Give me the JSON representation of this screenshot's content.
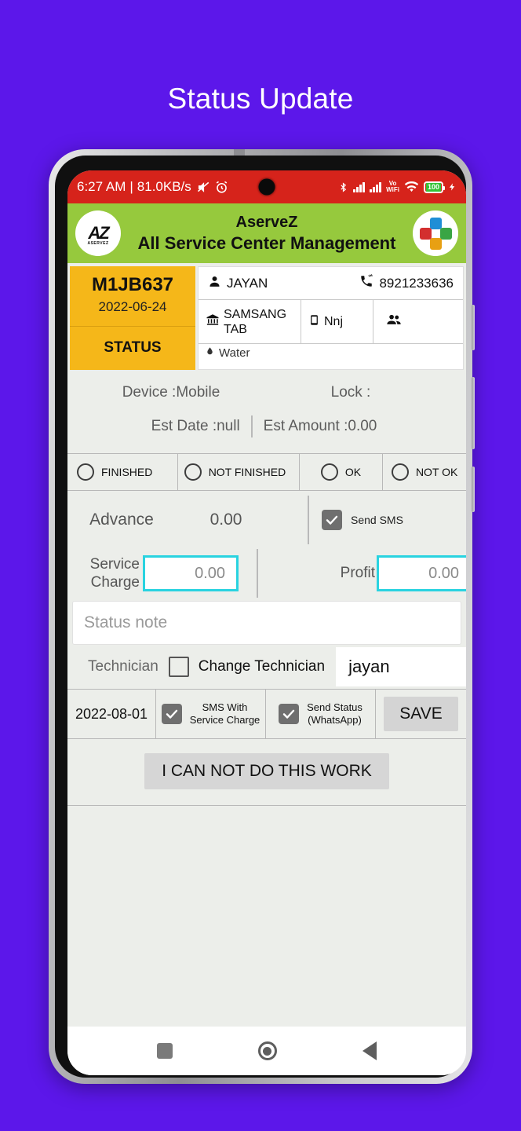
{
  "page": {
    "title": "Status Update",
    "background_color": "#5C17EA"
  },
  "status_bar": {
    "time": "6:27 AM",
    "separator": "|",
    "network_speed": "81.0KB/s",
    "mute_icon": "mute-icon",
    "alarm_icon": "alarm-icon",
    "bluetooth_icon": "bluetooth-icon",
    "signal_icon_1": "signal-bars-icon",
    "signal_icon_2": "signal-bars-icon",
    "volte_label": "Vo",
    "wifi_label": "WiFi",
    "wifi_icon": "wifi-icon",
    "battery_level": "100",
    "charging_icon": "charging-bolt-icon",
    "background_color": "#d6231b"
  },
  "app_header": {
    "title_line1": "AserveZ",
    "title_line2": "All Service Center Management",
    "left_logo": "aservez-logo-icon",
    "left_logo_text": "AZ",
    "left_logo_subtext": "ASERVEZ",
    "right_logo": "pinwheel-logo-icon",
    "background_color": "#96c93d"
  },
  "ticket": {
    "code": "M1JB637",
    "date": "2022-06-24",
    "status_label": "STATUS",
    "accent_color": "#F5B719",
    "customer_name": "JAYAN",
    "customer_name_icon": "person-icon",
    "phone": "8921233636",
    "phone_icon": "phone-call-icon",
    "device_brand": "SAMSANG TAB",
    "device_brand_icon": "bank-icon",
    "model": "Nnj",
    "model_icon": "mobile-icon",
    "group_icon": "people-group-icon",
    "partial_row_text": "Water",
    "partial_row_icon": "water-drop-icon"
  },
  "device_info": {
    "device_label": "Device :Mobile",
    "lock_label": "Lock :",
    "est_date_label": "Est Date :null",
    "est_amount_label": "Est Amount :0.00"
  },
  "status_options": [
    {
      "label": "FINISHED",
      "selected": false
    },
    {
      "label": "NOT FINISHED",
      "selected": false
    },
    {
      "label": "OK",
      "selected": false
    },
    {
      "label": "NOT OK",
      "selected": false
    }
  ],
  "advance": {
    "label": "Advance",
    "value": "0.00",
    "send_sms_label": "Send SMS",
    "send_sms_checked": true
  },
  "charges": {
    "service_charge_label": "Service Charge",
    "service_charge_value": "0.00",
    "profit_label": "Profit",
    "profit_value": "0.00",
    "field_border_color": "#29d3e0"
  },
  "status_note": {
    "placeholder": "Status note",
    "value": ""
  },
  "technician": {
    "label": "Technician",
    "change_label": "Change Technician",
    "change_checked": false,
    "name": "jayan"
  },
  "actions": {
    "date": "2022-08-01",
    "sms_with_service_charge_line1": "SMS With",
    "sms_with_service_charge_line2": "Service Charge",
    "sms_with_service_charge_checked": true,
    "send_status_line1": "Send Status",
    "send_status_line2": "(WhatsApp)",
    "send_status_checked": true,
    "save_label": "SAVE",
    "cannot_do_label": "I CAN NOT DO THIS WORK"
  },
  "nav_bar": {
    "recents_icon": "square-recents-icon",
    "home_icon": "circle-home-icon",
    "back_icon": "triangle-back-icon"
  }
}
